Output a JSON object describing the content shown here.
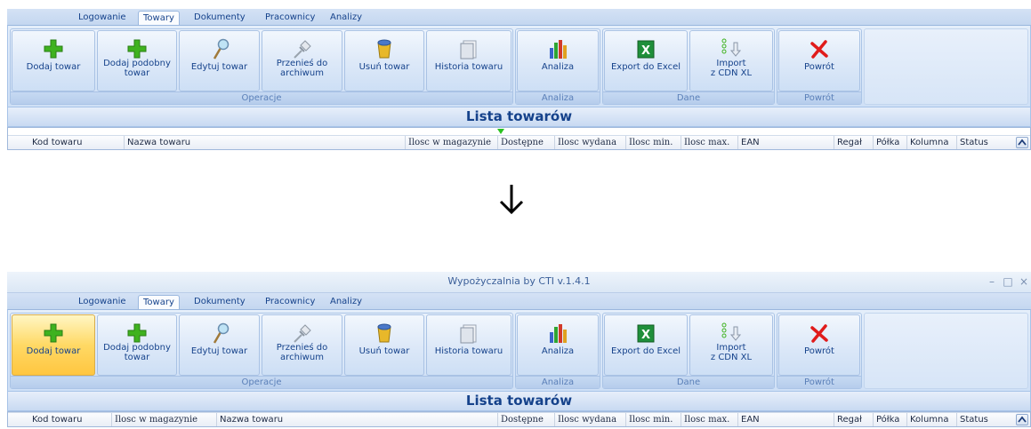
{
  "window": {
    "title": "Wypożyczalnia by CTI v.1.4.1",
    "controls": [
      "–",
      "□",
      "×"
    ]
  },
  "tabs": [
    {
      "label": "Logowanie"
    },
    {
      "label": "Towary"
    },
    {
      "label": "Dokumenty"
    },
    {
      "label": "Pracownicy"
    },
    {
      "label": "Analizy"
    }
  ],
  "active_tab": "Towary",
  "ribbon": {
    "groups": {
      "operacje": "Operacje",
      "analiza": "Analiza",
      "dane": "Dane",
      "powrot": "Powrót"
    },
    "buttons": {
      "dodaj_towar": "Dodaj towar",
      "dodaj_podobny_1": "Dodaj podobny",
      "dodaj_podobny_2": "towar",
      "edytuj_towar": "Edytuj towar",
      "przenies_1": "Przenieś do",
      "przenies_2": "archiwum",
      "usun_towar": "Usuń towar",
      "historia_towaru": "Historia towaru",
      "analiza": "Analiza",
      "export_excel": "Export do Excel",
      "import_1": "Import",
      "import_2": "z CDN XL",
      "powrot": "Powrót"
    }
  },
  "list_title": "Lista towarów",
  "columns_before": [
    "Kod towaru",
    "Nazwa towaru",
    "Ilosc w magazynie",
    "Dostępne",
    "Ilosc wydana",
    "Ilosc min.",
    "Ilosc max.",
    "EAN",
    "Regał",
    "Półka",
    "Kolumna",
    "Status"
  ],
  "columns_after": [
    "Kod towaru",
    "Ilosc w magazynie",
    "Nazwa towaru",
    "Dostępne",
    "Ilosc wydana",
    "Ilosc min.",
    "Ilosc max.",
    "EAN",
    "Regał",
    "Półka",
    "Kolumna",
    "Status"
  ],
  "colors": {
    "ribbon_blue": "#cfe0f6",
    "text_blue": "#15428b",
    "hover_orange": "#ffc640",
    "plus_green": "#3fb21f",
    "delete_red": "#e01b1b"
  }
}
